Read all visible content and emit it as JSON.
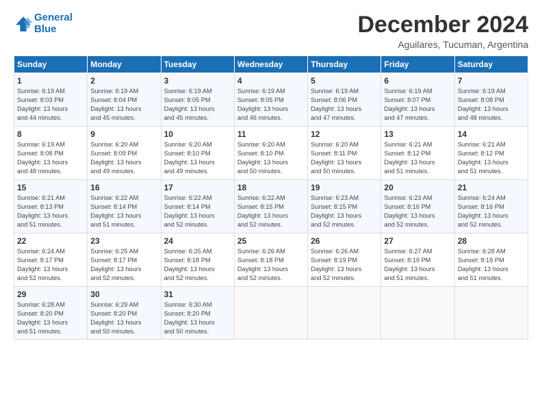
{
  "logo": {
    "line1": "General",
    "line2": "Blue"
  },
  "title": "December 2024",
  "subtitle": "Aguilares, Tucuman, Argentina",
  "header_days": [
    "Sunday",
    "Monday",
    "Tuesday",
    "Wednesday",
    "Thursday",
    "Friday",
    "Saturday"
  ],
  "weeks": [
    [
      {
        "day": "1",
        "info": "Sunrise: 6:19 AM\nSunset: 8:03 PM\nDaylight: 13 hours\nand 44 minutes."
      },
      {
        "day": "2",
        "info": "Sunrise: 6:19 AM\nSunset: 8:04 PM\nDaylight: 13 hours\nand 45 minutes."
      },
      {
        "day": "3",
        "info": "Sunrise: 6:19 AM\nSunset: 8:05 PM\nDaylight: 13 hours\nand 45 minutes."
      },
      {
        "day": "4",
        "info": "Sunrise: 6:19 AM\nSunset: 8:05 PM\nDaylight: 13 hours\nand 46 minutes."
      },
      {
        "day": "5",
        "info": "Sunrise: 6:19 AM\nSunset: 8:06 PM\nDaylight: 13 hours\nand 47 minutes."
      },
      {
        "day": "6",
        "info": "Sunrise: 6:19 AM\nSunset: 8:07 PM\nDaylight: 13 hours\nand 47 minutes."
      },
      {
        "day": "7",
        "info": "Sunrise: 6:19 AM\nSunset: 8:08 PM\nDaylight: 13 hours\nand 48 minutes."
      }
    ],
    [
      {
        "day": "8",
        "info": "Sunrise: 6:19 AM\nSunset: 8:08 PM\nDaylight: 13 hours\nand 48 minutes."
      },
      {
        "day": "9",
        "info": "Sunrise: 6:20 AM\nSunset: 8:09 PM\nDaylight: 13 hours\nand 49 minutes."
      },
      {
        "day": "10",
        "info": "Sunrise: 6:20 AM\nSunset: 8:10 PM\nDaylight: 13 hours\nand 49 minutes."
      },
      {
        "day": "11",
        "info": "Sunrise: 6:20 AM\nSunset: 8:10 PM\nDaylight: 13 hours\nand 50 minutes."
      },
      {
        "day": "12",
        "info": "Sunrise: 6:20 AM\nSunset: 8:11 PM\nDaylight: 13 hours\nand 50 minutes."
      },
      {
        "day": "13",
        "info": "Sunrise: 6:21 AM\nSunset: 8:12 PM\nDaylight: 13 hours\nand 51 minutes."
      },
      {
        "day": "14",
        "info": "Sunrise: 6:21 AM\nSunset: 8:12 PM\nDaylight: 13 hours\nand 51 minutes."
      }
    ],
    [
      {
        "day": "15",
        "info": "Sunrise: 6:21 AM\nSunset: 8:13 PM\nDaylight: 13 hours\nand 51 minutes."
      },
      {
        "day": "16",
        "info": "Sunrise: 6:22 AM\nSunset: 8:14 PM\nDaylight: 13 hours\nand 51 minutes."
      },
      {
        "day": "17",
        "info": "Sunrise: 6:22 AM\nSunset: 8:14 PM\nDaylight: 13 hours\nand 52 minutes."
      },
      {
        "day": "18",
        "info": "Sunrise: 6:22 AM\nSunset: 8:15 PM\nDaylight: 13 hours\nand 52 minutes."
      },
      {
        "day": "19",
        "info": "Sunrise: 6:23 AM\nSunset: 8:15 PM\nDaylight: 13 hours\nand 52 minutes."
      },
      {
        "day": "20",
        "info": "Sunrise: 6:23 AM\nSunset: 8:16 PM\nDaylight: 13 hours\nand 52 minutes."
      },
      {
        "day": "21",
        "info": "Sunrise: 6:24 AM\nSunset: 8:16 PM\nDaylight: 13 hours\nand 52 minutes."
      }
    ],
    [
      {
        "day": "22",
        "info": "Sunrise: 6:24 AM\nSunset: 8:17 PM\nDaylight: 13 hours\nand 52 minutes."
      },
      {
        "day": "23",
        "info": "Sunrise: 6:25 AM\nSunset: 8:17 PM\nDaylight: 13 hours\nand 52 minutes."
      },
      {
        "day": "24",
        "info": "Sunrise: 6:25 AM\nSunset: 8:18 PM\nDaylight: 13 hours\nand 52 minutes."
      },
      {
        "day": "25",
        "info": "Sunrise: 6:26 AM\nSunset: 8:18 PM\nDaylight: 13 hours\nand 52 minutes."
      },
      {
        "day": "26",
        "info": "Sunrise: 6:26 AM\nSunset: 8:19 PM\nDaylight: 13 hours\nand 52 minutes."
      },
      {
        "day": "27",
        "info": "Sunrise: 6:27 AM\nSunset: 8:19 PM\nDaylight: 13 hours\nand 51 minutes."
      },
      {
        "day": "28",
        "info": "Sunrise: 6:28 AM\nSunset: 8:19 PM\nDaylight: 13 hours\nand 51 minutes."
      }
    ],
    [
      {
        "day": "29",
        "info": "Sunrise: 6:28 AM\nSunset: 8:20 PM\nDaylight: 13 hours\nand 51 minutes."
      },
      {
        "day": "30",
        "info": "Sunrise: 6:29 AM\nSunset: 8:20 PM\nDaylight: 13 hours\nand 50 minutes."
      },
      {
        "day": "31",
        "info": "Sunrise: 6:30 AM\nSunset: 8:20 PM\nDaylight: 13 hours\nand 50 minutes."
      },
      {
        "day": "",
        "info": ""
      },
      {
        "day": "",
        "info": ""
      },
      {
        "day": "",
        "info": ""
      },
      {
        "day": "",
        "info": ""
      }
    ]
  ]
}
